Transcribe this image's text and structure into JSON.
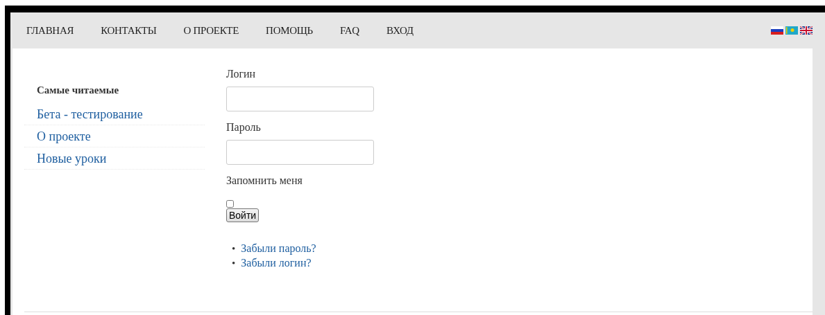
{
  "nav": {
    "items": [
      {
        "label": "ГЛАВНАЯ"
      },
      {
        "label": "КОНТАКТЫ"
      },
      {
        "label": "О ПРОЕКТЕ"
      },
      {
        "label": "ПОМОЩЬ"
      },
      {
        "label": "FAQ"
      },
      {
        "label": "ВХОД"
      }
    ],
    "flags": [
      {
        "kind": "ru"
      },
      {
        "kind": "kz"
      },
      {
        "kind": "gb"
      }
    ]
  },
  "sidebar": {
    "title": "Самые читаемые",
    "items": [
      {
        "label": "Бета - тестирование"
      },
      {
        "label": "О проекте"
      },
      {
        "label": "Новые уроки"
      }
    ]
  },
  "login": {
    "username_label": "Логин",
    "password_label": "Пароль",
    "remember_label": "Запомнить меня",
    "remember_checked": false,
    "submit": "Войти",
    "links": [
      {
        "bullet": "•",
        "label": "Забыли пароль?"
      },
      {
        "bullet": "•",
        "label": "Забыли логин?"
      }
    ]
  }
}
